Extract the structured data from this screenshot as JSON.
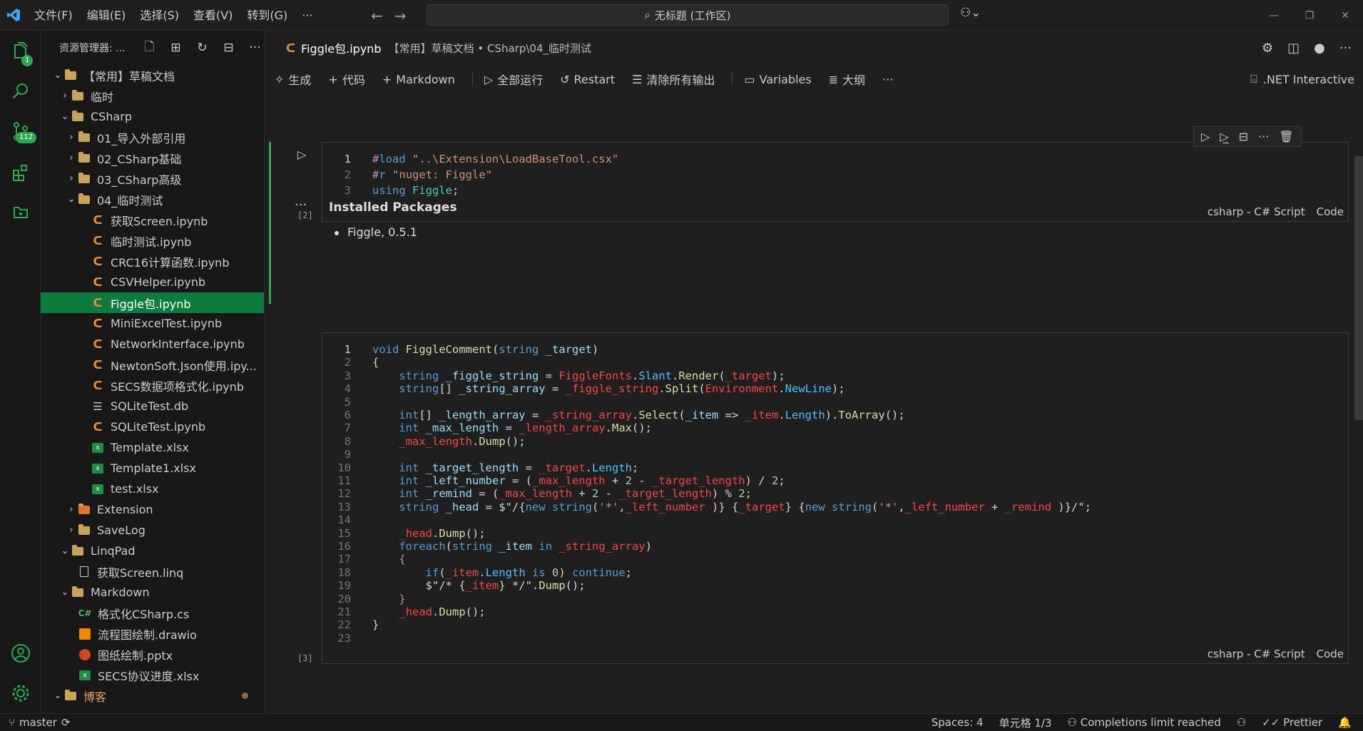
{
  "menu": [
    "文件(F)",
    "编辑(E)",
    "选择(S)",
    "查看(V)",
    "转到(G)",
    "···"
  ],
  "search": {
    "text": "无标题 (工作区)"
  },
  "activity": {
    "explorer_badge": "1",
    "scm_badge": "112"
  },
  "sidebar": {
    "title": "资源管理器: ...",
    "tree": [
      {
        "label": "【常用】草稿文档",
        "type": "folder",
        "depth": 0,
        "open": true
      },
      {
        "label": "临时",
        "type": "folder",
        "depth": 1,
        "open": false
      },
      {
        "label": "CSharp",
        "type": "folder",
        "depth": 1,
        "open": true
      },
      {
        "label": "01_导入外部引用",
        "type": "folder",
        "depth": 2,
        "open": false
      },
      {
        "label": "02_CSharp基础",
        "type": "folder",
        "depth": 2,
        "open": false
      },
      {
        "label": "03_CSharp高级",
        "type": "folder",
        "depth": 2,
        "open": false
      },
      {
        "label": "04_临时测试",
        "type": "folder",
        "depth": 2,
        "open": true
      },
      {
        "label": "获取Screen.ipynb",
        "type": "nb",
        "depth": 3
      },
      {
        "label": "临时测试.ipynb",
        "type": "nb",
        "depth": 3
      },
      {
        "label": "CRC16计算函数.ipynb",
        "type": "nb",
        "depth": 3
      },
      {
        "label": "CSVHelper.ipynb",
        "type": "nb",
        "depth": 3
      },
      {
        "label": "Figgle包.ipynb",
        "type": "nb",
        "depth": 3,
        "selected": true
      },
      {
        "label": "MiniExcelTest.ipynb",
        "type": "nb",
        "depth": 3
      },
      {
        "label": "NetworkInterface.ipynb",
        "type": "nb",
        "depth": 3
      },
      {
        "label": "NewtonSoft.Json使用.ipy...",
        "type": "nb",
        "depth": 3
      },
      {
        "label": "SECS数据项格式化.ipynb",
        "type": "nb",
        "depth": 3
      },
      {
        "label": "SQLiteTest.db",
        "type": "db",
        "depth": 3
      },
      {
        "label": "SQLiteTest.ipynb",
        "type": "nb",
        "depth": 3
      },
      {
        "label": "Template.xlsx",
        "type": "xl",
        "depth": 3
      },
      {
        "label": "Template1.xlsx",
        "type": "xl",
        "depth": 3
      },
      {
        "label": "test.xlsx",
        "type": "xl",
        "depth": 3
      },
      {
        "label": "Extension",
        "type": "folder-orange",
        "depth": 2,
        "open": false
      },
      {
        "label": "SaveLog",
        "type": "folder",
        "depth": 2,
        "open": false
      },
      {
        "label": "LinqPad",
        "type": "folder",
        "depth": 1,
        "open": true
      },
      {
        "label": "获取Screen.linq",
        "type": "file",
        "depth": 2
      },
      {
        "label": "Markdown",
        "type": "folder",
        "depth": 1,
        "open": true
      },
      {
        "label": "格式化CSharp.cs",
        "type": "cs",
        "depth": 1.5
      },
      {
        "label": "流程图绘制.drawio",
        "type": "drawio",
        "depth": 1.5
      },
      {
        "label": "图纸绘制.pptx",
        "type": "pptx",
        "depth": 1.5
      },
      {
        "label": "SECS协议进度.xlsx",
        "type": "xl",
        "depth": 1.5
      },
      {
        "label": "博客",
        "type": "folder",
        "depth": 0,
        "open": true,
        "orange_label": true
      }
    ]
  },
  "tab": {
    "title": "Figgle包.ipynb",
    "path": "【常用】草稿文档 • CSharp\\04_临时测试"
  },
  "toolbar": {
    "generate": "生成",
    "code": "代码",
    "markdown": "Markdown",
    "run_all": "全部运行",
    "restart": "Restart",
    "clear": "清除所有输出",
    "variables": "Variables",
    "outline": "大纲",
    "kernel": ".NET Interactive"
  },
  "cell1": {
    "exec": "[2]",
    "lang": "csharp - C# Script",
    "kind": "Code"
  },
  "output": {
    "title": "Installed Packages",
    "items": [
      "Figgle, 0.5.1"
    ]
  },
  "cell2": {
    "exec": "[3]",
    "lang": "csharp - C# Script",
    "kind": "Code"
  },
  "status": {
    "branch": "master",
    "spaces": "Spaces: 4",
    "cell": "单元格 1/3",
    "completions": "Completions limit reached",
    "prettier": "Prettier"
  }
}
